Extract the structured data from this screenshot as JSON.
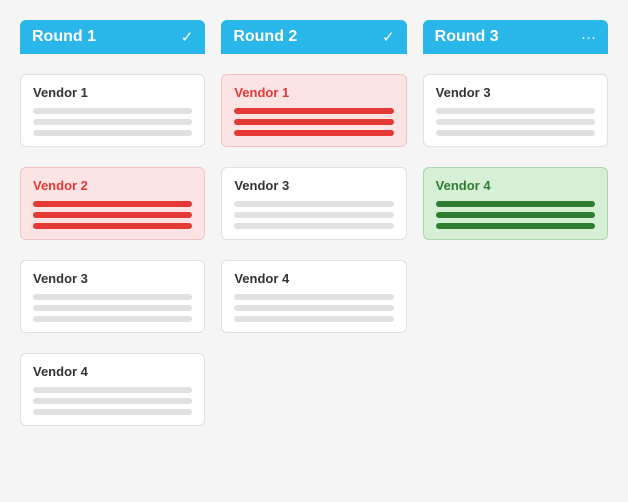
{
  "rounds": [
    {
      "id": "round1",
      "label": "Round 1",
      "icon": "✓",
      "icon_name": "checkmark-icon",
      "vendors": [
        {
          "name": "Vendor 1",
          "style": "normal",
          "bars": [
            "normal",
            "normal",
            "normal"
          ]
        },
        {
          "name": "Vendor 2",
          "style": "red",
          "bars": [
            "red",
            "red",
            "red"
          ]
        },
        {
          "name": "Vendor 3",
          "style": "normal",
          "bars": [
            "normal",
            "normal",
            "normal"
          ]
        },
        {
          "name": "Vendor 4",
          "style": "normal",
          "bars": [
            "normal",
            "normal",
            "normal"
          ]
        }
      ]
    },
    {
      "id": "round2",
      "label": "Round 2",
      "icon": "✓",
      "icon_name": "checkmark-icon",
      "vendors": [
        {
          "name": "Vendor 1",
          "style": "red",
          "bars": [
            "red",
            "red",
            "red"
          ]
        },
        {
          "name": "Vendor 3",
          "style": "normal",
          "bars": [
            "normal",
            "normal",
            "normal"
          ]
        },
        {
          "name": "Vendor 4",
          "style": "normal",
          "bars": [
            "normal",
            "normal",
            "normal"
          ]
        }
      ]
    },
    {
      "id": "round3",
      "label": "Round 3",
      "icon": "···",
      "icon_name": "more-icon",
      "vendors": [
        {
          "name": "Vendor 3",
          "style": "normal",
          "bars": [
            "normal",
            "normal",
            "normal"
          ]
        },
        {
          "name": "Vendor 4",
          "style": "green",
          "bars": [
            "green",
            "green",
            "green"
          ]
        }
      ]
    }
  ]
}
